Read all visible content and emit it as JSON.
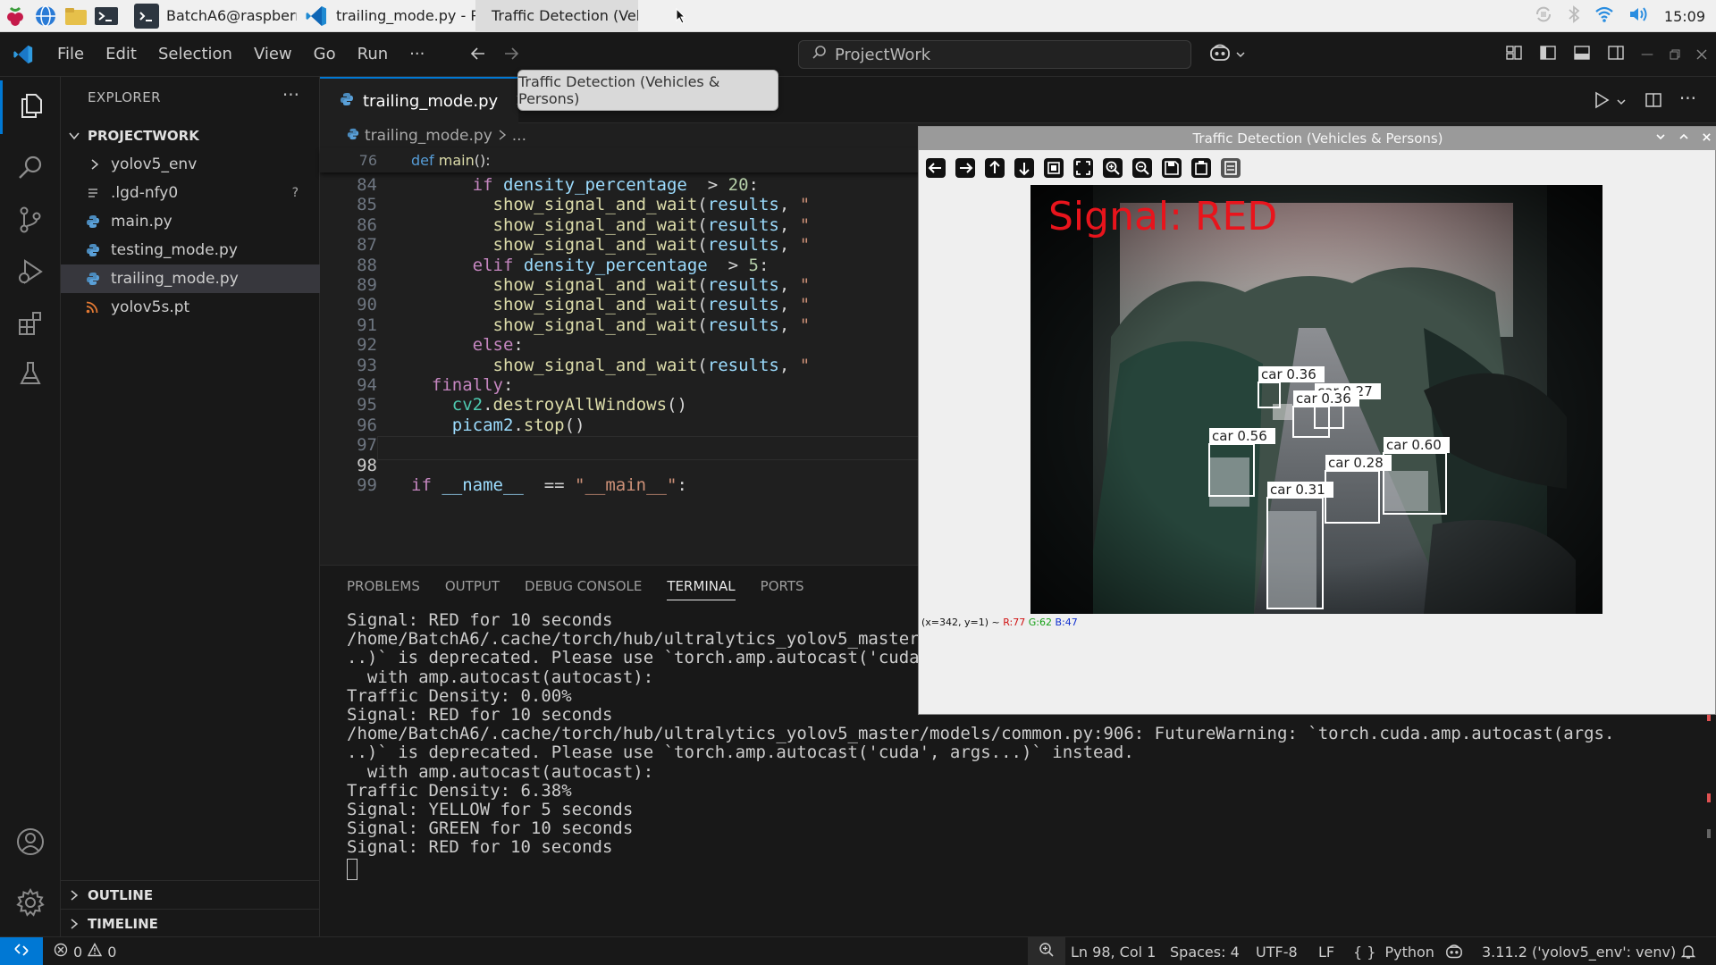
{
  "taskbar": {
    "tasks": [
      {
        "label": "BatchA6@raspberry..."
      },
      {
        "label": "trailing_mode.py - Pr..."
      },
      {
        "label": "Traffic Detection (Vehic"
      }
    ],
    "clock": "15:09"
  },
  "titlebar": {
    "menu": [
      "File",
      "Edit",
      "Selection",
      "View",
      "Go",
      "Run",
      "···"
    ],
    "search": "ProjectWork",
    "tooltip": "Traffic Detection (Vehicles & Persons)"
  },
  "explorer": {
    "title": "EXPLORER",
    "project": "PROJECTWORK",
    "items": [
      {
        "label": "yolov5_env",
        "kind": "folder",
        "badge": ""
      },
      {
        "label": ".lgd-nfy0",
        "kind": "text",
        "badge": "?"
      },
      {
        "label": "main.py",
        "kind": "python",
        "badge": ""
      },
      {
        "label": "testing_mode.py",
        "kind": "python",
        "badge": ""
      },
      {
        "label": "trailing_mode.py",
        "kind": "python",
        "badge": ""
      },
      {
        "label": "yolov5s.pt",
        "kind": "rss",
        "badge": ""
      }
    ],
    "outline": "OUTLINE",
    "timeline": "TIMELINE"
  },
  "editor": {
    "tab": "trailing_mode.py",
    "breadcrumb_file": "trailing_mode.py",
    "breadcrumb_more": "...",
    "sticky": {
      "num": "76",
      "kw": "def",
      "fn": "main",
      "rest": "():"
    },
    "lines": [
      {
        "num": "84",
        "indent": "      ",
        "tokens": [
          [
            "kw2",
            "if "
          ],
          [
            "vr",
            "density_percentage"
          ],
          [
            "",
            "  > "
          ],
          [
            "nu",
            "20"
          ],
          [
            "",
            ":"
          ]
        ]
      },
      {
        "num": "85",
        "indent": "        ",
        "tokens": [
          [
            "fn",
            "show_signal_and_wait"
          ],
          [
            "",
            "("
          ],
          [
            "vr",
            "results"
          ],
          [
            "",
            ", "
          ],
          [
            "st",
            "\""
          ]
        ]
      },
      {
        "num": "86",
        "indent": "        ",
        "tokens": [
          [
            "fn",
            "show_signal_and_wait"
          ],
          [
            "",
            "("
          ],
          [
            "vr",
            "results"
          ],
          [
            "",
            ", "
          ],
          [
            "st",
            "\""
          ]
        ]
      },
      {
        "num": "87",
        "indent": "        ",
        "tokens": [
          [
            "fn",
            "show_signal_and_wait"
          ],
          [
            "",
            "("
          ],
          [
            "vr",
            "results"
          ],
          [
            "",
            ", "
          ],
          [
            "st",
            "\""
          ]
        ]
      },
      {
        "num": "88",
        "indent": "      ",
        "tokens": [
          [
            "kw2",
            "elif "
          ],
          [
            "vr",
            "density_percentage"
          ],
          [
            "",
            "  > "
          ],
          [
            "nu",
            "5"
          ],
          [
            "",
            ":"
          ]
        ]
      },
      {
        "num": "89",
        "indent": "        ",
        "tokens": [
          [
            "fn",
            "show_signal_and_wait"
          ],
          [
            "",
            "("
          ],
          [
            "vr",
            "results"
          ],
          [
            "",
            ", "
          ],
          [
            "st",
            "\""
          ]
        ]
      },
      {
        "num": "90",
        "indent": "        ",
        "tokens": [
          [
            "fn",
            "show_signal_and_wait"
          ],
          [
            "",
            "("
          ],
          [
            "vr",
            "results"
          ],
          [
            "",
            ", "
          ],
          [
            "st",
            "\""
          ]
        ]
      },
      {
        "num": "91",
        "indent": "        ",
        "tokens": [
          [
            "fn",
            "show_signal_and_wait"
          ],
          [
            "",
            "("
          ],
          [
            "vr",
            "results"
          ],
          [
            "",
            ", "
          ],
          [
            "st",
            "\""
          ]
        ]
      },
      {
        "num": "92",
        "indent": "      ",
        "tokens": [
          [
            "kw2",
            "else"
          ],
          [
            "",
            ":"
          ]
        ]
      },
      {
        "num": "93",
        "indent": "        ",
        "tokens": [
          [
            "fn",
            "show_signal_and_wait"
          ],
          [
            "",
            "("
          ],
          [
            "vr",
            "results"
          ],
          [
            "",
            ", "
          ],
          [
            "st",
            "\""
          ]
        ]
      },
      {
        "num": "94",
        "indent": "  ",
        "tokens": [
          [
            "kw2",
            "finally"
          ],
          [
            "",
            ":"
          ]
        ]
      },
      {
        "num": "95",
        "indent": "    ",
        "tokens": [
          [
            "cy",
            "cv2"
          ],
          [
            "",
            "."
          ],
          [
            "fn",
            "destroyAllWindows"
          ],
          [
            "",
            "()"
          ]
        ]
      },
      {
        "num": "96",
        "indent": "    ",
        "tokens": [
          [
            "vr",
            "picam2"
          ],
          [
            "",
            "."
          ],
          [
            "fn",
            "stop"
          ],
          [
            "",
            "()"
          ]
        ]
      },
      {
        "num": "97",
        "indent": "",
        "tokens": []
      },
      {
        "num": "98",
        "indent": "",
        "tokens": []
      },
      {
        "num": "99",
        "indent": "",
        "tokens": [
          [
            "kw2",
            "if "
          ],
          [
            "vr",
            "__name__"
          ],
          [
            "",
            "  == "
          ],
          [
            "st",
            "\"__main__\""
          ],
          [
            "",
            ":"
          ]
        ]
      }
    ]
  },
  "panel": {
    "tabs": [
      "PROBLEMS",
      "OUTPUT",
      "DEBUG CONSOLE",
      "TERMINAL",
      "PORTS"
    ],
    "active_tab": "TERMINAL",
    "lines": [
      "Signal: RED for 10 seconds",
      "/home/BatchA6/.cache/torch/hub/ultralytics_yolov5_master/models/common.py:906: FutureWarning: `torch.cuda.amp.autocast(args.",
      "..)` is deprecated. Please use `torch.amp.autocast('cuda', args...)` instead.",
      "  with amp.autocast(autocast):",
      "Traffic Density: 0.00%",
      "Signal: RED for 10 seconds",
      "/home/BatchA6/.cache/torch/hub/ultralytics_yolov5_master/models/common.py:906: FutureWarning: `torch.cuda.amp.autocast(args.",
      "..)` is deprecated. Please use `torch.amp.autocast('cuda', args...)` instead.",
      "  with amp.autocast(autocast):",
      "Traffic Density: 6.38%",
      "Signal: YELLOW for 5 seconds",
      "Signal: GREEN for 10 seconds",
      "Signal: RED for 10 seconds"
    ]
  },
  "statusbar": {
    "errors": "0",
    "warnings": "0",
    "position": "Ln 98, Col 1",
    "spaces": "Spaces: 4",
    "encoding": "UTF-8",
    "eol": "LF",
    "language": "Python",
    "interpreter": "3.11.2 ('yolov5_env': venv)"
  },
  "cv_window": {
    "title": "Traffic Detection (Vehicles & Persons)",
    "signal_text": "Signal:  RED",
    "signal_color": "#e8141c",
    "detections": [
      {
        "label": "car 0.36"
      },
      {
        "label": "car 0.27"
      },
      {
        "label": "car 0.36"
      },
      {
        "label": "car 0.56"
      },
      {
        "label": "car 0.60"
      },
      {
        "label": "car 0.28"
      },
      {
        "label": "car 0.31"
      }
    ],
    "status_prefix": "(x=342, y=1) ~",
    "r": "R:77",
    "g": "G:62",
    "b": "B:47"
  },
  "colors": {
    "accent": "#0078d4",
    "editor_bg": "#1f1f1f",
    "sidebar_bg": "#181818"
  }
}
